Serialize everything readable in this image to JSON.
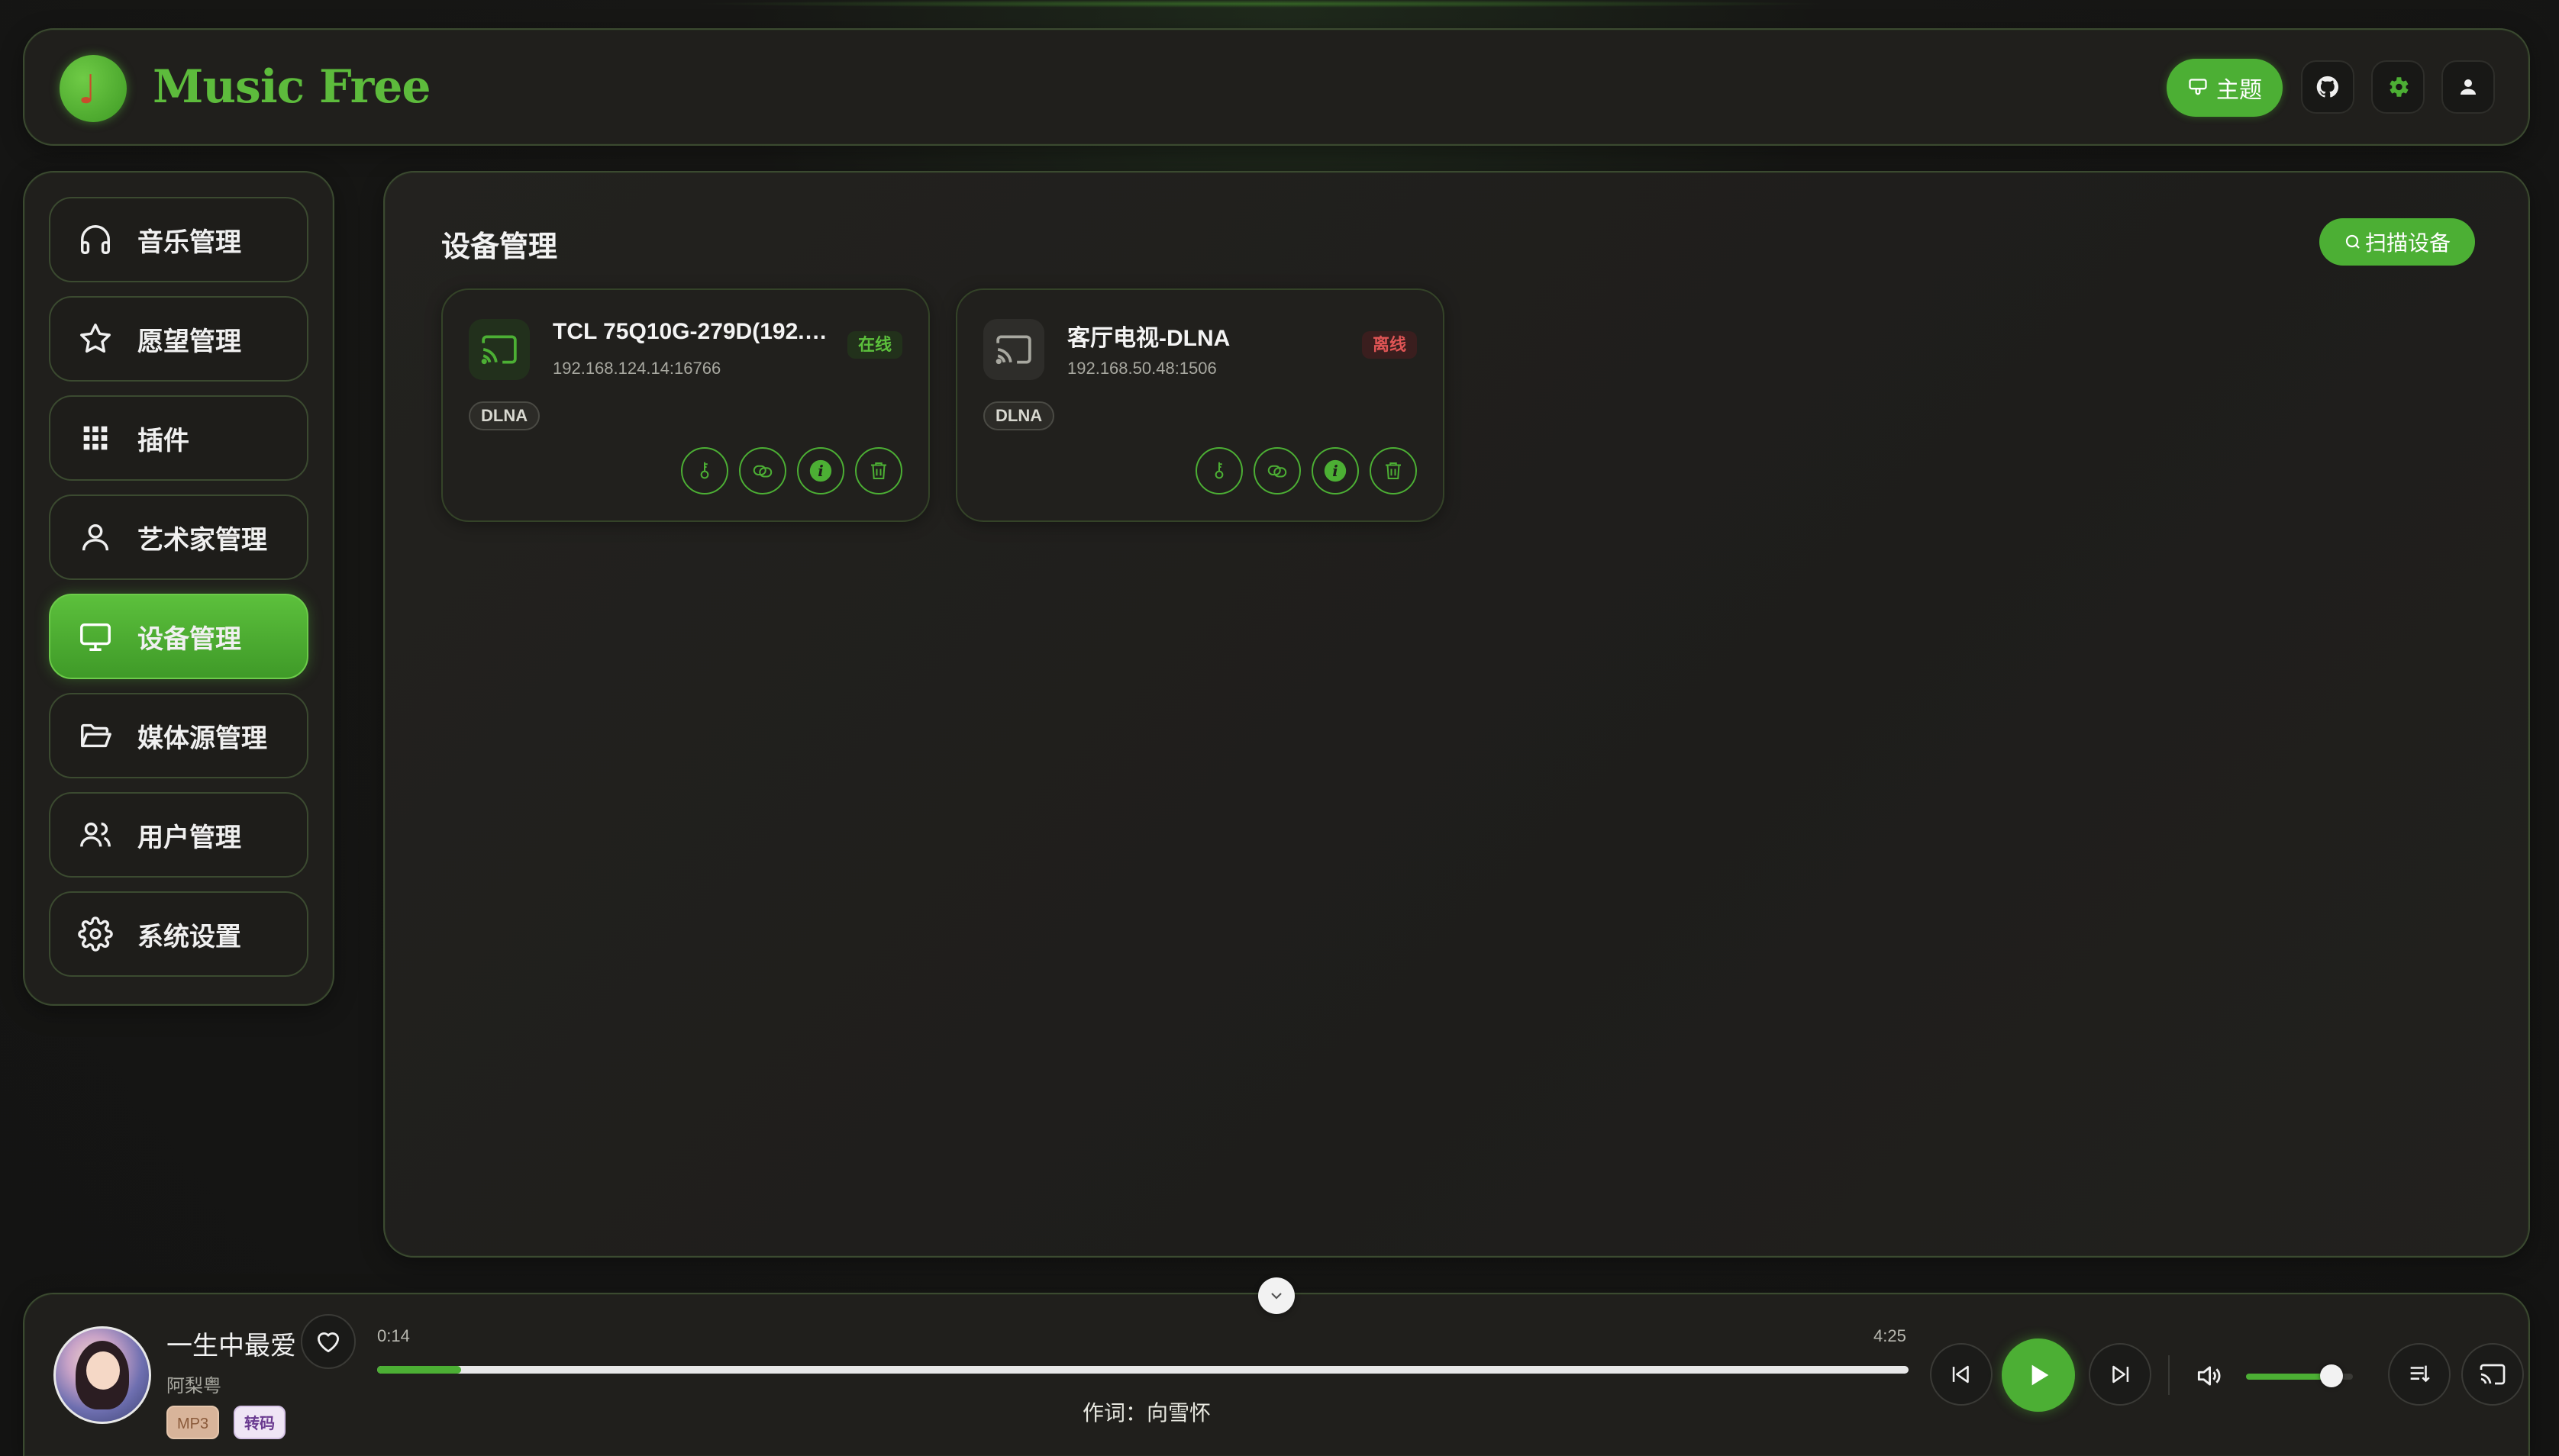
{
  "app": {
    "title": "Music Free",
    "logo_glyph": "♩"
  },
  "header": {
    "theme_label": "主题",
    "icons": [
      "palette-icon",
      "github-icon",
      "gear-icon",
      "user-icon"
    ]
  },
  "sidebar": {
    "items": [
      {
        "label": "音乐管理",
        "icon": "headphones-icon",
        "active": false
      },
      {
        "label": "愿望管理",
        "icon": "star-icon",
        "active": false
      },
      {
        "label": "插件",
        "icon": "grid-icon",
        "active": false
      },
      {
        "label": "艺术家管理",
        "icon": "user-icon",
        "active": false
      },
      {
        "label": "设备管理",
        "icon": "monitor-icon",
        "active": true
      },
      {
        "label": "媒体源管理",
        "icon": "folder-icon",
        "active": false
      },
      {
        "label": "用户管理",
        "icon": "users-icon",
        "active": false
      },
      {
        "label": "系统设置",
        "icon": "gear-icon",
        "active": false
      }
    ]
  },
  "main": {
    "title": "设备管理",
    "scan_label": "扫描设备",
    "devices": [
      {
        "name": "TCL 75Q10G-279D(192.1...",
        "ip": "192.168.124.14:16766",
        "status": "在线",
        "online": true,
        "type": "DLNA"
      },
      {
        "name": "客厅电视-DLNA",
        "ip": "192.168.50.48:1506",
        "status": "离线",
        "online": false,
        "type": "DLNA"
      }
    ]
  },
  "player": {
    "title": "一生中最爱",
    "artist": "阿梨粤",
    "format": "MP3",
    "transcode": "转码",
    "current_time": "0:14",
    "total_time": "4:25",
    "progress": 0.055,
    "lyric": "作词：向雪怀",
    "volume": 0.8
  },
  "colors": {
    "accent": "#4caf34",
    "online": "#5cc03c",
    "offline": "#e05555",
    "background": "#171715"
  }
}
